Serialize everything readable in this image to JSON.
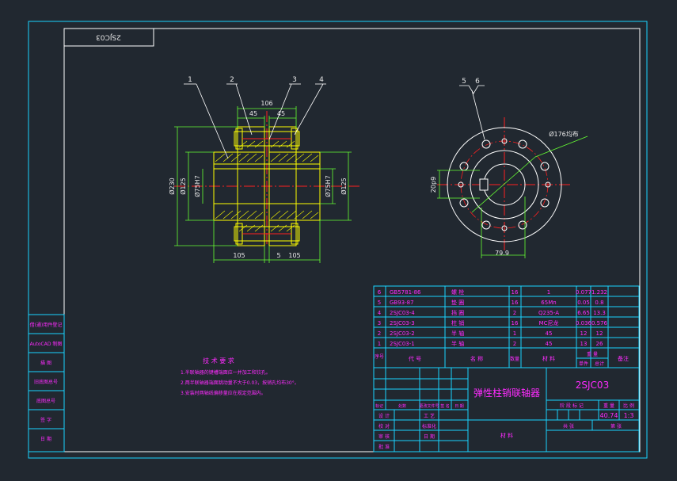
{
  "colors": {
    "background": "#212830",
    "frame": "#ffffff",
    "border_cyan": "#19d3ff",
    "part_yellow": "#ffff00",
    "dimension_green": "#66ff33",
    "center_red": "#ff2020",
    "label_magenta": "#ff2bff",
    "table_cyan": "#19d3ff"
  },
  "drawing_code_stamp": "2SJC03",
  "leaders": {
    "n1": "1",
    "n2": "2",
    "n3": "3",
    "n4": "4",
    "n5": "5",
    "n6": "6"
  },
  "dims": {
    "d106": "106",
    "d45a": "45",
    "d45b": "45",
    "d230": "Ø230",
    "d125": "Ø125",
    "d75h7": "Ø75H7",
    "d75h7_right": "Ø75H7",
    "d125_right": "Ø125",
    "d105a": "105",
    "d5": "5",
    "d105b": "105",
    "d176": "Ø176均布",
    "d20p9": "20p9",
    "d79_9": "79.9"
  },
  "tech_req": {
    "title": "技 术 要 求",
    "line1": "1.半联轴器的键槽端面应一并加工和铰孔。",
    "line2": "2.两半联轴器端面跳动量不大于0.03，按销孔均布30°。",
    "line3": "3.安装时两轴线偏移量应在规定范围内。"
  },
  "sidebar": [
    "借(通)用件登记",
    "AutoCAD 制图",
    "描  图",
    "旧底图总号",
    "底图总号",
    "签  字",
    "日  期"
  ],
  "bom": [
    {
      "no": "6",
      "code": "GB5781-86",
      "name": "螺  栓",
      "qty": "16",
      "material": "1",
      "w1": "0.077",
      "w2": "1.232"
    },
    {
      "no": "5",
      "code": "GB93-87",
      "name": "垫  圈",
      "qty": "16",
      "material": "65Mn",
      "w1": "0.05",
      "w2": "0.8"
    },
    {
      "no": "4",
      "code": "2SJC03-4",
      "name": "挡  圈",
      "qty": "2",
      "material": "Q235-A",
      "w1": "6.65",
      "w2": "13.3"
    },
    {
      "no": "3",
      "code": "2SJC03-3",
      "name": "柱  销",
      "qty": "16",
      "material": "MC尼龙",
      "w1": "0.036",
      "w2": "0.576"
    },
    {
      "no": "2",
      "code": "2SJC03-2",
      "name": "半  轴",
      "qty": "1",
      "material": "45",
      "w1": "12",
      "w2": "12"
    },
    {
      "no": "1",
      "code": "2SJC03-1",
      "name": "半  轴",
      "qty": "2",
      "material": "45",
      "w1": "13",
      "w2": "26"
    }
  ],
  "bom_header": {
    "no": "序号",
    "code": "代    号",
    "name": "名    称",
    "qty": "数量",
    "material": "材    料",
    "unit": "单件",
    "total": "总计",
    "weight": "重  量",
    "remark": "备注"
  },
  "title_block": {
    "part_name": "弹性柱销联轴器",
    "drawing_no": "2SJC03",
    "stage_label": "阶 段 标 记",
    "weight_label": "重  量",
    "scale_label": "比  例",
    "weight": "40.74",
    "scale": "1:3",
    "sheet_total": "共     张",
    "sheet_no": "第     张",
    "material_field": "材  料",
    "rows_left": [
      "标记",
      "处数",
      "更改文件号",
      "签  名",
      "日  期"
    ],
    "roles": [
      "设  计",
      "校  对",
      "审  核",
      "批  准"
    ],
    "roles_mid": [
      "工  艺",
      "标准化",
      "日  期"
    ],
    "company": "",
    "zone": "分  区"
  }
}
